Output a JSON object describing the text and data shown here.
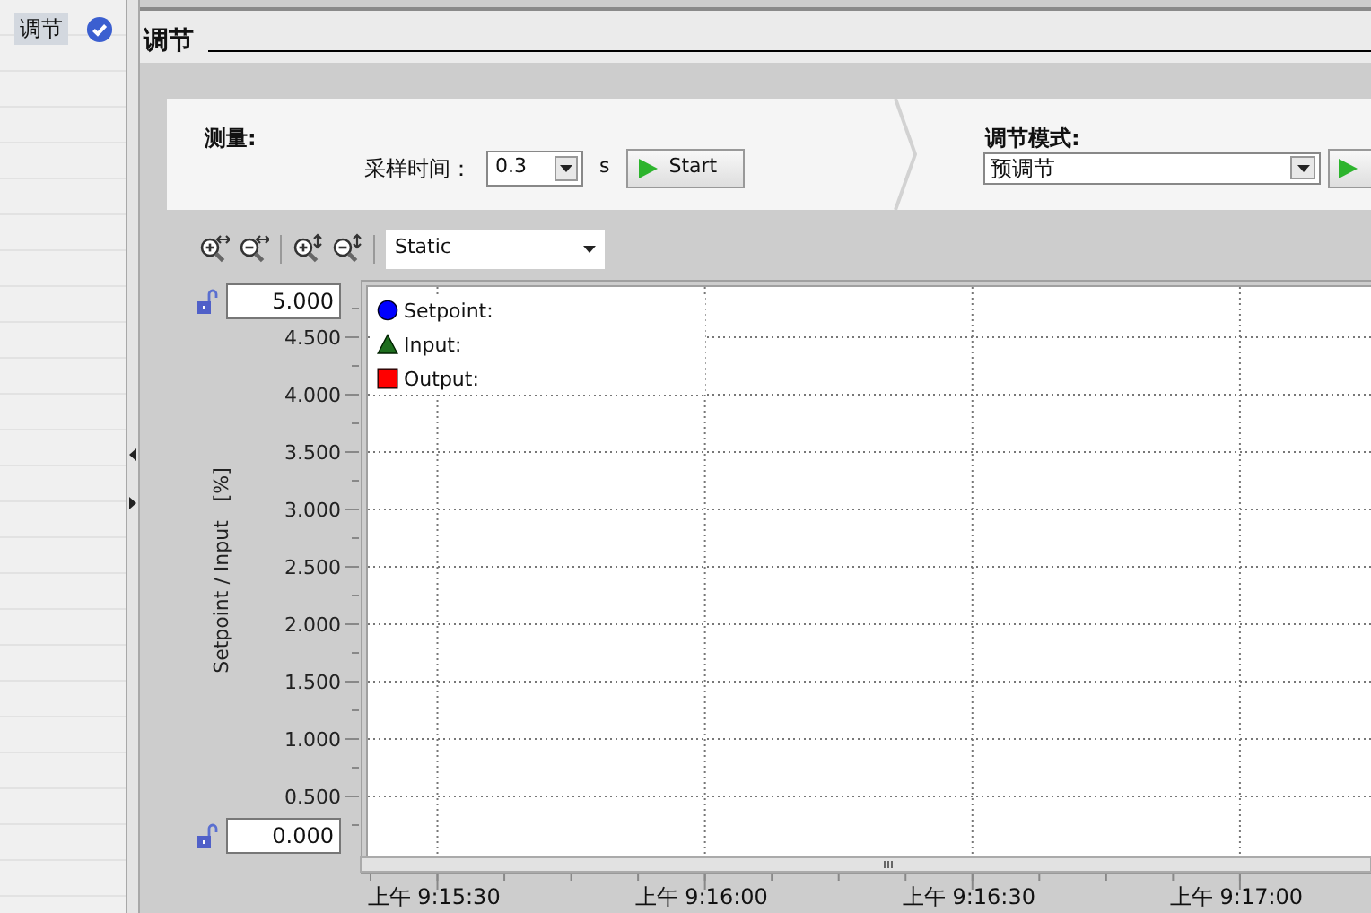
{
  "sidebar": {
    "items": [
      {
        "label": "调节",
        "selected": true,
        "checked": true
      }
    ]
  },
  "editor": {
    "title": "调节"
  },
  "measurement": {
    "title": "测量:",
    "sampling_label": "采样时间：",
    "sampling_value": "0.3",
    "unit": "s",
    "start_button": "Start"
  },
  "tuning": {
    "title": "调节模式:",
    "mode_value": "预调节"
  },
  "toolbar": {
    "view_mode": "Static"
  },
  "chart": {
    "top_field": "5.000",
    "bottom_field": "0.000",
    "legend": [
      {
        "label": "Setpoint:",
        "kind": "circle",
        "color": "#0000ff"
      },
      {
        "label": "Input:",
        "kind": "triangle",
        "color": "#1e6e1e"
      },
      {
        "label": "Output:",
        "kind": "square",
        "color": "#ff0000"
      }
    ],
    "chart_data": {
      "type": "line",
      "grid": true,
      "categories": [
        "上午 9:15:30",
        "上午 9:16:00",
        "上午 9:16:30",
        "上午 9:17:00"
      ],
      "ylabel": "Setpoint / Input   [%]",
      "ylim": [
        0,
        5
      ],
      "yticks": [
        {
          "value": 0.5,
          "label": "0.500"
        },
        {
          "value": 1,
          "label": "1.000"
        },
        {
          "value": 1.5,
          "label": "1.500"
        },
        {
          "value": 2,
          "label": "2.000"
        },
        {
          "value": 2.5,
          "label": "2.500"
        },
        {
          "value": 3,
          "label": "3.000"
        },
        {
          "value": 3.5,
          "label": "3.500"
        },
        {
          "value": 4,
          "label": "4.000"
        },
        {
          "value": 4.5,
          "label": "4.500"
        }
      ]
    }
  }
}
